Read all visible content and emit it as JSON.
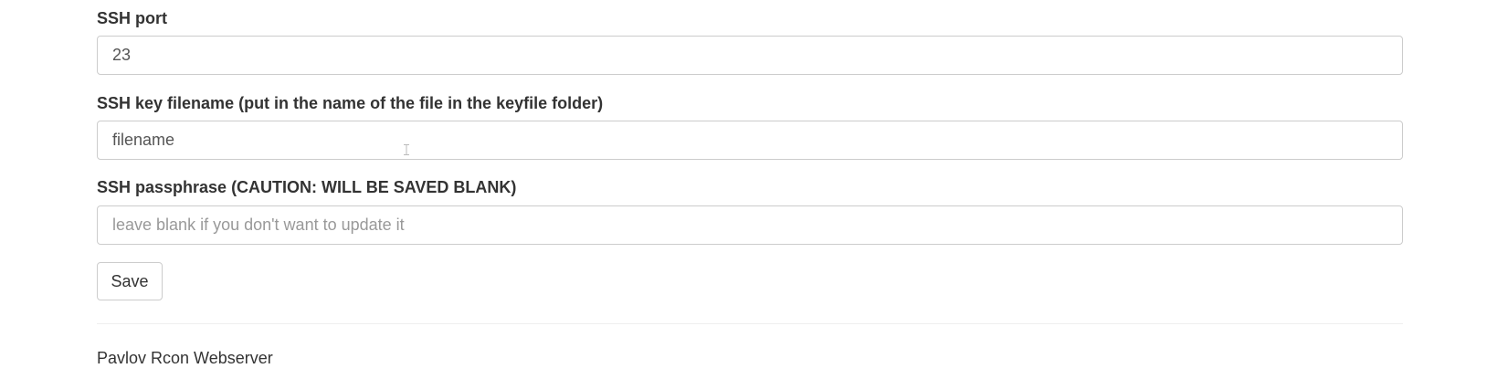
{
  "form": {
    "ssh_port": {
      "label": "SSH port",
      "value": "23",
      "placeholder": ""
    },
    "ssh_keyfile": {
      "label": "SSH key filename (put in the name of the file in the keyfile folder)",
      "value": "filename",
      "placeholder": ""
    },
    "ssh_passphrase": {
      "label": "SSH passphrase (CAUTION: WILL BE SAVED BLANK)",
      "value": "",
      "placeholder": "leave blank if you don't want to update it"
    },
    "save_label": "Save"
  },
  "footer": {
    "text": "Pavlov Rcon Webserver"
  },
  "colors": {
    "text": "#333333",
    "input_border": "#cccccc",
    "placeholder": "#999999",
    "divider": "#eeeeee"
  }
}
